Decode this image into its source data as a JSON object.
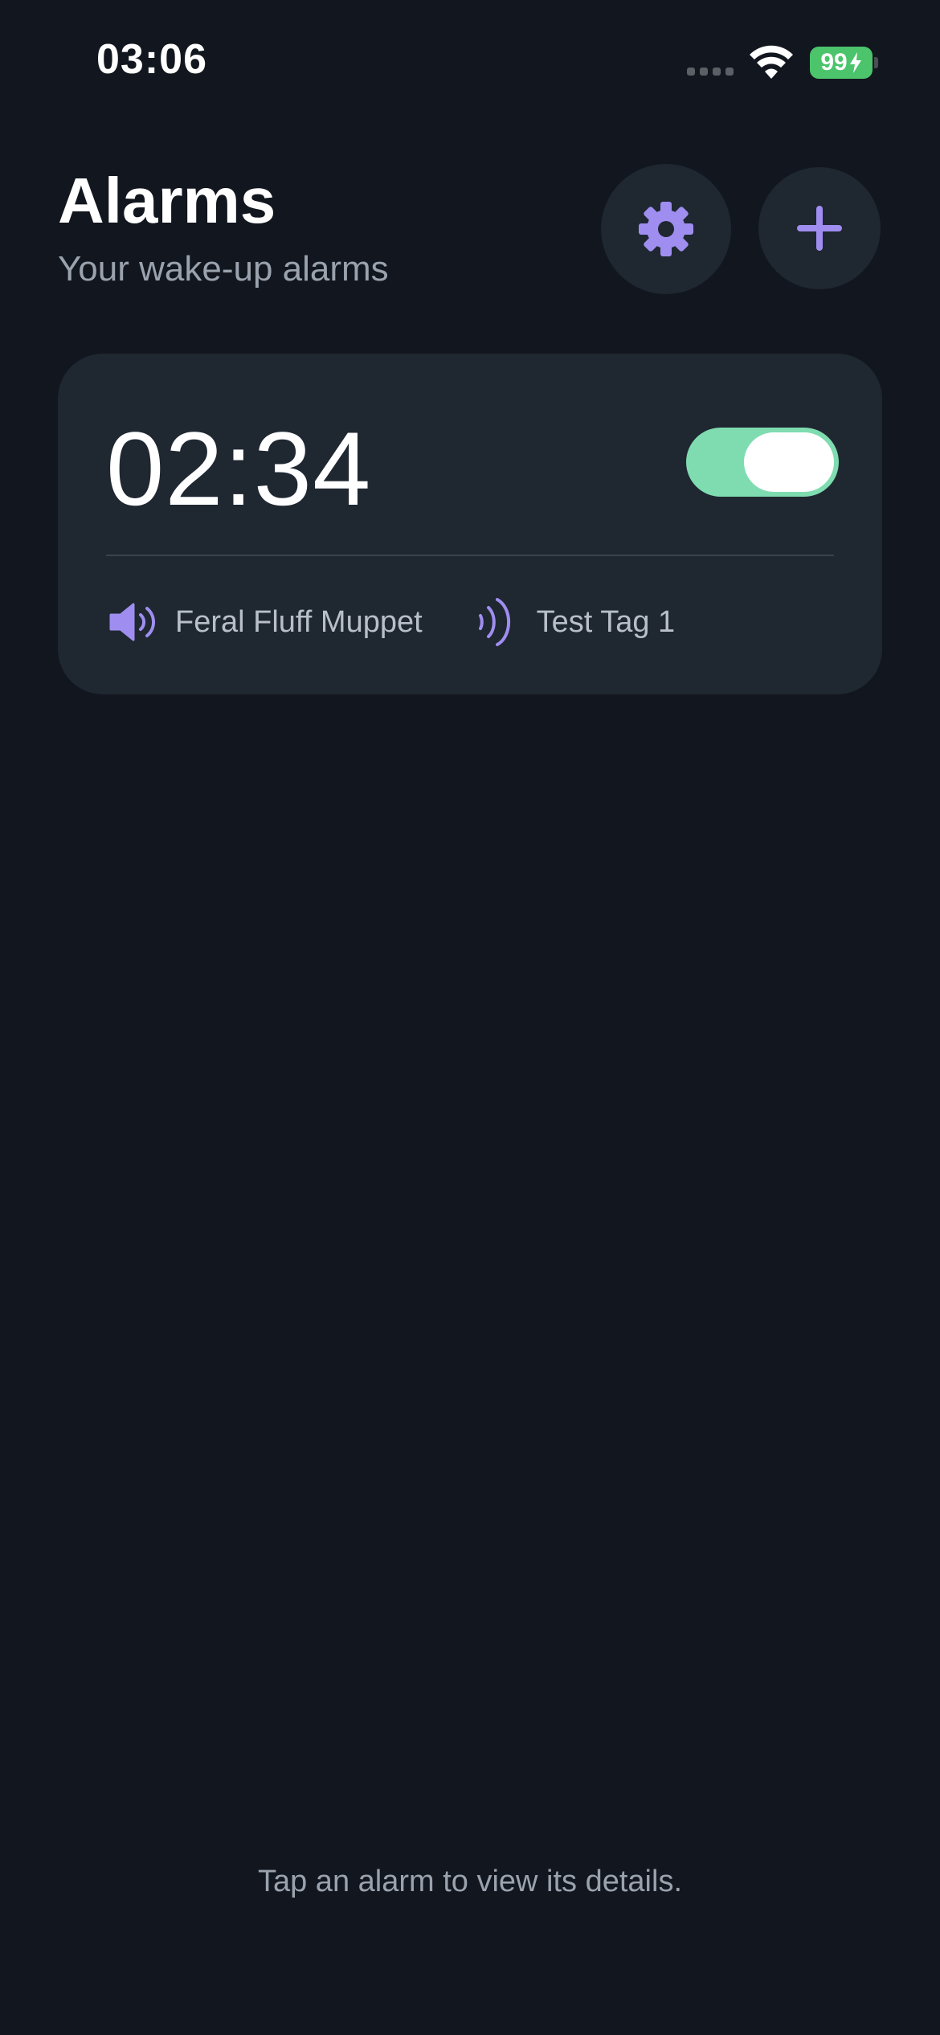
{
  "status_bar": {
    "time": "03:06",
    "battery": "99"
  },
  "header": {
    "title": "Alarms",
    "subtitle": "Your wake-up alarms"
  },
  "icons": {
    "settings": "gear-icon",
    "add": "plus-icon",
    "sound": "speaker-icon",
    "tag": "nfc-icon"
  },
  "colors": {
    "accent": "#9f8ef0",
    "toggle_on": "#7fdcb0",
    "background": "#12161e",
    "card": "#1f2731",
    "battery": "#4bc46b"
  },
  "alarms": [
    {
      "time": "02:34",
      "enabled": true,
      "sound": "Feral Fluff Muppet",
      "tag": "Test Tag 1"
    }
  ],
  "footer": {
    "hint": "Tap an alarm to view its details."
  }
}
